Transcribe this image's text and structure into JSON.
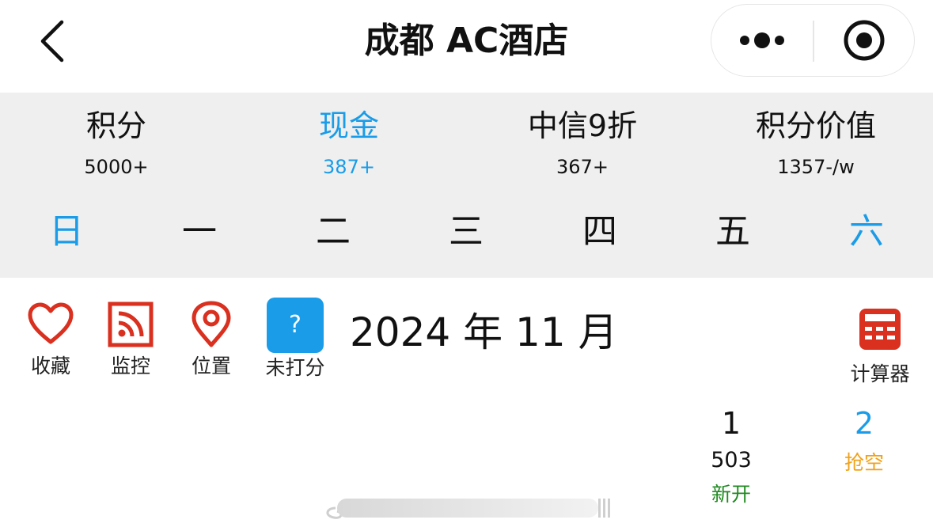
{
  "nav": {
    "title": "成都 AC酒店",
    "back_icon": "chevron-left-icon",
    "more_icon": "more-dots-icon",
    "close_icon": "target-circle-icon"
  },
  "summary": {
    "stats": [
      {
        "label": "积分",
        "value": "5000+",
        "highlight": false
      },
      {
        "label": "现金",
        "value": "387+",
        "highlight": true
      },
      {
        "label": "中信9折",
        "value": "367+",
        "highlight": false
      },
      {
        "label": "积分价值",
        "value": "1357-/w",
        "highlight": false
      }
    ],
    "weekdays": [
      "日",
      "一",
      "二",
      "三",
      "四",
      "五",
      "六"
    ]
  },
  "tools": {
    "favorite": {
      "label": "收藏",
      "icon": "heart-icon"
    },
    "monitor": {
      "label": "监控",
      "icon": "rss-feed-icon"
    },
    "location": {
      "label": "位置",
      "icon": "map-pin-icon"
    },
    "unrated": {
      "label": "未打分",
      "icon": "question-mark-icon",
      "badge_text": "?"
    },
    "calculator": {
      "label": "计算器",
      "icon": "calculator-icon"
    }
  },
  "calendar": {
    "month_title": "2024 年 11 月",
    "days": [
      {
        "day": "1",
        "price": "503",
        "status": "新开"
      },
      {
        "day": "2",
        "price": "",
        "status": "抢空"
      }
    ]
  },
  "colors": {
    "accent_blue": "#1a9ce8",
    "icon_red": "#d9301f",
    "status_green": "#1f8a1f",
    "status_orange": "#f0a21a",
    "summary_bg": "#efefef"
  }
}
